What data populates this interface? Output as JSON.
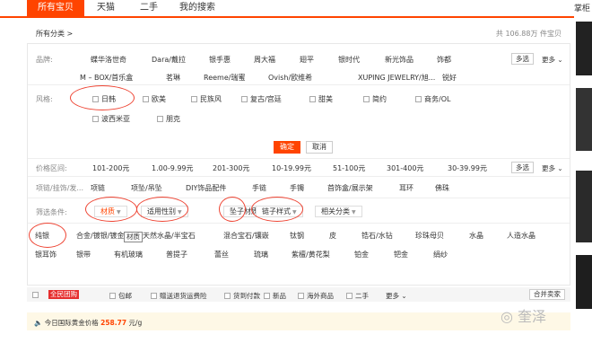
{
  "tabs": [
    "所有宝贝",
    "天猫",
    "二手",
    "我的搜索"
  ],
  "crumb": "所有分类 >",
  "count": "共 106.88万 件宝贝",
  "brand": {
    "label": "品牌:",
    "row1": [
      "蝶华洛世奇",
      "Dara/戴拉",
      "银手惠",
      "周大福",
      "翅平",
      "银时代",
      "新光饰品",
      "饰都"
    ],
    "row2": [
      "M – BOX/首乐盒",
      "茗琳",
      "Reeme/瑞蜜",
      "Ovish/欧维希",
      "XUPING JEWELRY/旭...",
      "锐好"
    ],
    "multi": "多选",
    "more": "更多"
  },
  "style": {
    "label": "风格:",
    "row1": [
      "日韩",
      "欧美",
      "民族风",
      "复古/宫廷",
      "甜美",
      "简约",
      "商务/OL"
    ],
    "row2": [
      "波西米亚",
      "朋克"
    ]
  },
  "buttons": {
    "confirm": "确定",
    "cancel": "取消"
  },
  "price": {
    "label": "价格区间:",
    "items": [
      "101-200元",
      "1.00-9.99元",
      "201-300元",
      "10-19.99元",
      "51-100元",
      "301-400元",
      "30-39.99元"
    ],
    "multi": "多选",
    "more": "更多"
  },
  "categories": {
    "label": "项链/挂饰/发...",
    "items": [
      "项链",
      "项坠/吊坠",
      "DIY饰品配件",
      "手链",
      "手镯",
      "首饰盒/展示架",
      "耳环",
      "佛珠"
    ]
  },
  "filters": {
    "label": "筛选条件:",
    "items": [
      "材质",
      "适用性别",
      "坠子材质",
      "链子样式",
      "相关分类"
    ]
  },
  "tooltip": "材质",
  "materials": {
    "row1": [
      "纯银",
      "合金/镀银/镀金",
      "天然水晶/半宝石",
      "混合宝石/镶嵌",
      "钛钢",
      "皮",
      "锆石/水钻",
      "珍珠母贝",
      "水晶",
      "人造水晶"
    ],
    "row2": [
      "银耳饰",
      "银带",
      "有机玻璃",
      "普提子",
      "蕾丝",
      "琉璃",
      "紫檀/黄花梨",
      "铂金",
      "钯金",
      "绢纱"
    ]
  },
  "bar": {
    "items": [
      "全民团购",
      "包邮",
      "赠送退货运费险",
      "货到付款",
      "新品",
      "海外商品",
      "二手"
    ],
    "more": "更多",
    "combine": "合并卖家"
  },
  "gold": {
    "label": "今日国际黄金价格",
    "price": "258.77",
    "unit": "元/g"
  },
  "side": {
    "header": "掌柜"
  },
  "watermark": "奎泽"
}
